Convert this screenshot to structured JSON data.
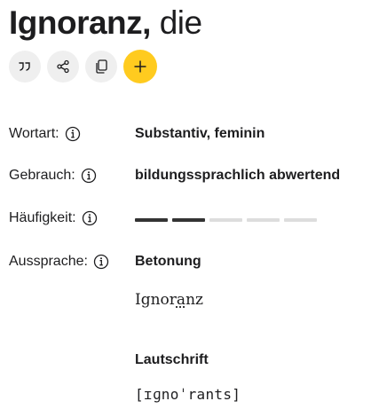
{
  "entry": {
    "lemma": "Ignoranz,",
    "article": "die"
  },
  "actions": [
    {
      "name": "quote",
      "icon": "quote-icon"
    },
    {
      "name": "share",
      "icon": "share-icon"
    },
    {
      "name": "copy",
      "icon": "copy-icon"
    },
    {
      "name": "add",
      "icon": "plus-icon"
    }
  ],
  "rows": {
    "wortart": {
      "label": "Wortart:",
      "value": "Substantiv, feminin"
    },
    "gebrauch": {
      "label": "Gebrauch:",
      "value": "bildungssprachlich abwertend"
    },
    "haeufigkeit": {
      "label": "Häufigkeit:",
      "level": 2,
      "max": 5
    },
    "aussprache": {
      "label": "Aussprache:",
      "betonung_heading": "Betonung",
      "betonung_before": "Ignor",
      "betonung_stressed": "a",
      "betonung_after": "nz",
      "lautschrift_heading": "Lautschrift",
      "lautschrift": "[ɪɡnoˈrants]"
    }
  },
  "colors": {
    "accent": "#ffcb1f",
    "button_bg": "#efefef",
    "freq_active": "#333333",
    "freq_inactive": "#dddddd"
  }
}
